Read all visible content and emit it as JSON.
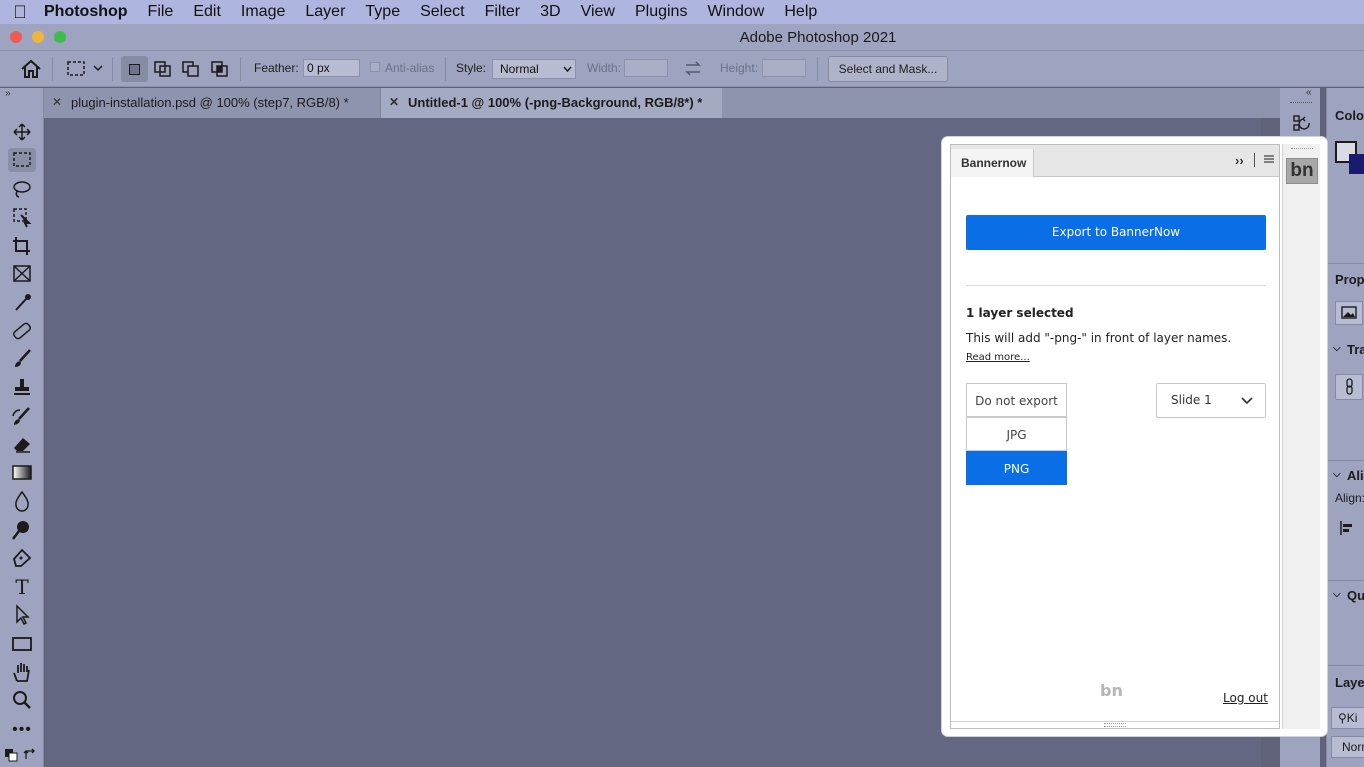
{
  "menubar": {
    "app_name": "Photoshop",
    "items": [
      "File",
      "Edit",
      "Image",
      "Layer",
      "Type",
      "Select",
      "Filter",
      "3D",
      "View",
      "Plugins",
      "Window",
      "Help"
    ]
  },
  "window": {
    "title": "Adobe Photoshop 2021"
  },
  "options_bar": {
    "feather_label": "Feather:",
    "feather_value": "0 px",
    "antialias_label": "Anti-alias",
    "style_label": "Style:",
    "style_value": "Normal",
    "width_label": "Width:",
    "height_label": "Height:",
    "select_mask_label": "Select and Mask..."
  },
  "tabs": [
    {
      "label": "plugin-installation.psd @ 100% (step7, RGB/8) *",
      "active": false
    },
    {
      "label": "Untitled-1 @ 100% (-png-Background, RGB/8*) *",
      "active": true
    }
  ],
  "right_panel": {
    "color_label": "Color",
    "properties_label": "Prope",
    "transform_label": "Tra",
    "align_label": "Ali",
    "align_sub": "Align:",
    "quick_label": "Qu",
    "layers_label": "Layer",
    "kind_label": "Ki",
    "blend_label": "Norm"
  },
  "plugin": {
    "tab_label": "Bannernow",
    "export_button": "Export to BannerNow",
    "selected_info": "1 layer selected",
    "hint": "This will add \"-png-\" in front of layer names.",
    "read_more": "Read more...",
    "formats": [
      "Do not export",
      "JPG",
      "PNG"
    ],
    "selected_format": "PNG",
    "slide_value": "Slide 1",
    "footer_logo": "bn",
    "logout": "Log out",
    "side_logo": "bn"
  },
  "colors": {
    "accent": "#0a6ee6",
    "canvas": "#646782",
    "chrome": "#9ea4bf"
  }
}
